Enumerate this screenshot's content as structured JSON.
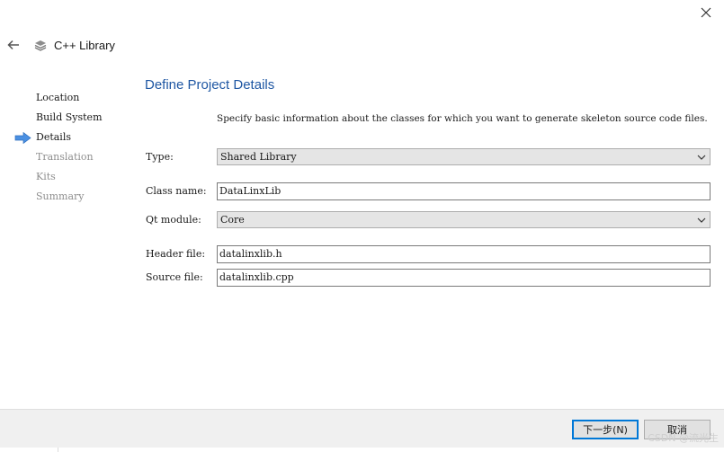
{
  "window": {
    "title": "C++ Library"
  },
  "page": {
    "title": "Define Project Details",
    "description": "Specify basic information about the classes for which you want to generate skeleton source code files."
  },
  "steps": [
    {
      "label": "Location",
      "state": "done"
    },
    {
      "label": "Build System",
      "state": "done"
    },
    {
      "label": "Details",
      "state": "current"
    },
    {
      "label": "Translation",
      "state": "pending"
    },
    {
      "label": "Kits",
      "state": "pending"
    },
    {
      "label": "Summary",
      "state": "pending"
    }
  ],
  "form": {
    "type": {
      "label": "Type:",
      "value": "Shared Library"
    },
    "class_name": {
      "label": "Class name:",
      "value": "DataLinxLib"
    },
    "qt_module": {
      "label": "Qt module:",
      "value": "Core"
    },
    "header_file": {
      "label": "Header file:",
      "value": "datalinxlib.h"
    },
    "source_file": {
      "label": "Source file:",
      "value": "datalinxlib.cpp"
    }
  },
  "buttons": {
    "next": "下一步(N)",
    "cancel": "取消"
  },
  "watermark": "CSDN @流光生",
  "colors": {
    "title_blue": "#1f57a3",
    "step_arrow": "#4a90e2",
    "default_button_border": "#0078d7"
  },
  "icons": {
    "close": "close-icon",
    "back": "back-arrow-icon",
    "library": "library-stack-icon",
    "current_step": "current-step-arrow-icon",
    "dropdown": "chevron-down-icon"
  }
}
